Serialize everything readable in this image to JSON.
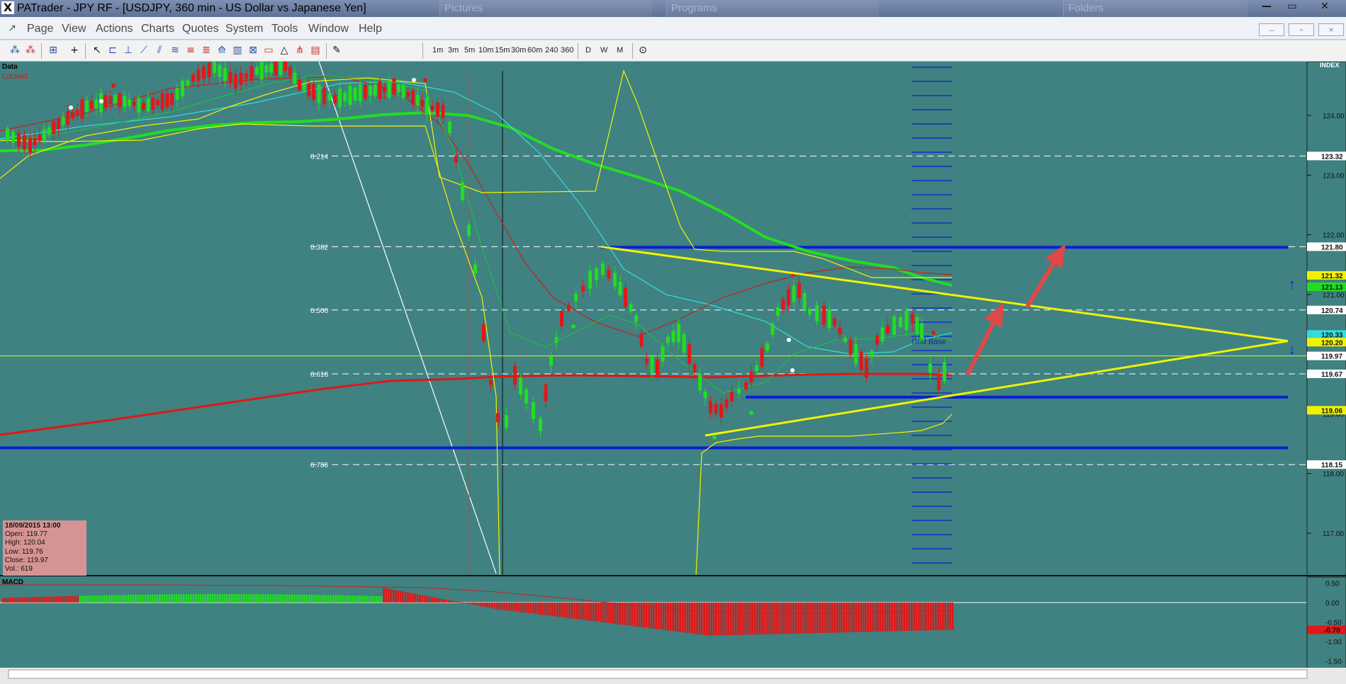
{
  "window": {
    "app_logo": "X",
    "title": "PATrader - JPY RF - [USDJPY, 360 min - US Dollar vs Japanese Yen]",
    "background_windows": [
      "Pictures",
      "Programs",
      "Folders"
    ],
    "controls": {
      "minimize": "—",
      "maximize": "▭",
      "close": "✕"
    }
  },
  "menu": {
    "items": [
      "Page",
      "View",
      "Actions",
      "Charts",
      "Quotes",
      "System",
      "Tools",
      "Window",
      "Help"
    ],
    "mdi_controls": {
      "minimize": "–",
      "restore": "▫",
      "close": "×"
    }
  },
  "toolbar": {
    "timeframes": [
      "1m",
      "3m",
      "5m",
      "10m",
      "15m",
      "30m",
      "60m",
      "240",
      "360"
    ],
    "periods": [
      "D",
      "W",
      "M"
    ],
    "clock_icon": "⊙"
  },
  "chart_data": {
    "type": "candlestick",
    "symbol": "USDJPY",
    "timeframe": "360 min",
    "labels": {
      "data": "Data",
      "locked": "Locked",
      "index": "INDEX",
      "grid_base": "Grid Base",
      "macd": "MACD"
    },
    "price_axis": {
      "ticks": [
        124.0,
        123.0,
        122.0,
        121.0,
        120.0,
        119.0,
        118.0,
        117.0
      ],
      "tick_labels": [
        "124.00",
        "123.00",
        "122.00",
        "121.00",
        "120.00",
        "119.00",
        "118.00",
        "117.00"
      ],
      "ylim": [
        116.3,
        124.9
      ]
    },
    "fibonacci": [
      {
        "level": "0.214",
        "price": 123.32
      },
      {
        "level": "0.382",
        "price": 121.8
      },
      {
        "level": "0.500",
        "price": 120.74
      },
      {
        "level": "0.618",
        "price": 119.67
      },
      {
        "level": "0.786",
        "price": 118.15
      }
    ],
    "price_labels": [
      {
        "text": "123.32",
        "price": 123.32,
        "color": "#ffffff"
      },
      {
        "text": "121.80",
        "price": 121.8,
        "color": "#ffffff"
      },
      {
        "text": "121.32",
        "price": 121.32,
        "color": "#f2f200"
      },
      {
        "text": "121.13",
        "price": 121.13,
        "color": "#22dd22"
      },
      {
        "text": "120.74",
        "price": 120.74,
        "color": "#ffffff"
      },
      {
        "text": "120.33",
        "price": 120.33,
        "color": "#33dddd"
      },
      {
        "text": "120.20",
        "price": 120.2,
        "color": "#f2f200"
      },
      {
        "text": "119.97",
        "price": 119.97,
        "color": "#ffffff"
      },
      {
        "text": "119.67",
        "price": 119.67,
        "color": "#ffffff"
      },
      {
        "text": "119.06",
        "price": 119.06,
        "color": "#f2f200"
      },
      {
        "text": "118.15",
        "price": 118.15,
        "color": "#ffffff"
      }
    ],
    "horizontal_lines": [
      {
        "price": 121.79,
        "color": "#0a1fd0"
      },
      {
        "price": 119.28,
        "color": "#0a1fd0"
      },
      {
        "price": 118.43,
        "color": "#0a1fd0"
      }
    ],
    "current_price_line": 119.97,
    "last_bar": {
      "date": "18/09/2015 13:00",
      "open": "Open: 119.77",
      "high": "High: 120.04",
      "low": "Low: 119.76",
      "close": "Close: 119.97",
      "volume": "Vol.: 619"
    },
    "macd_axis": {
      "tick_labels": [
        "0.50",
        "0.00",
        "-0.50",
        "-1.00",
        "-1.50"
      ],
      "ticks": [
        0.5,
        0.0,
        -0.5,
        -1.0,
        -1.5
      ],
      "current_value": "-0.70",
      "current": -0.7
    },
    "colors": {
      "bull": "#22dd22",
      "bear": "#e01818",
      "background": "#3f8281",
      "trendline": "#f2f200",
      "arrow": "#e04848"
    }
  }
}
